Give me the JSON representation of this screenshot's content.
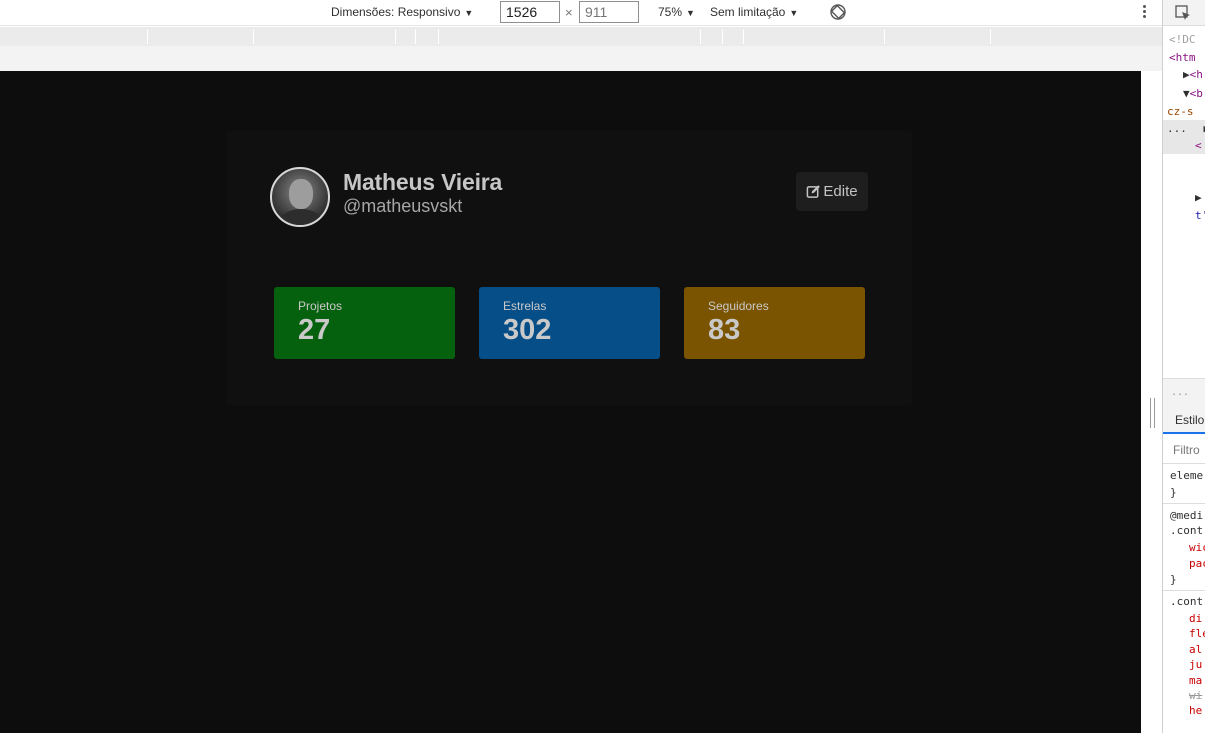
{
  "device_toolbar": {
    "dimensions_label": "Dimensões: Responsivo",
    "width_value": "1526",
    "height_placeholder": "911",
    "times_symbol": "×",
    "zoom_label": "75%",
    "throttle_label": "Sem limitação",
    "caret": "▼"
  },
  "profile": {
    "name": "Matheus Vieira",
    "username": "@matheusvskt",
    "edit_label": "Edite"
  },
  "stats": [
    {
      "label": "Projetos",
      "value": "27",
      "color": "#06610f"
    },
    {
      "label": "Estrelas",
      "value": "302",
      "color": "#064e87"
    },
    {
      "label": "Seguidores",
      "value": "83",
      "color": "#7a5400"
    }
  ],
  "devtools": {
    "elements_lines": [
      "<!DC",
      "<htm",
      "<h",
      "<b",
      "cz-s",
      "<",
      "t'"
    ],
    "panel_dots": "...",
    "styles_tab": "Estilo",
    "filter_placeholder": "Filtro",
    "style_lines": [
      "eleme",
      "}",
      "@medi",
      ".cont",
      "wic",
      "pac",
      "}",
      ".cont",
      "di",
      "fle",
      "al",
      "ju",
      "ma",
      "wi",
      "he"
    ]
  },
  "colors": {
    "page_background": "#0d0d0d",
    "card_background": "#111010",
    "text": "#c6c6c6"
  }
}
